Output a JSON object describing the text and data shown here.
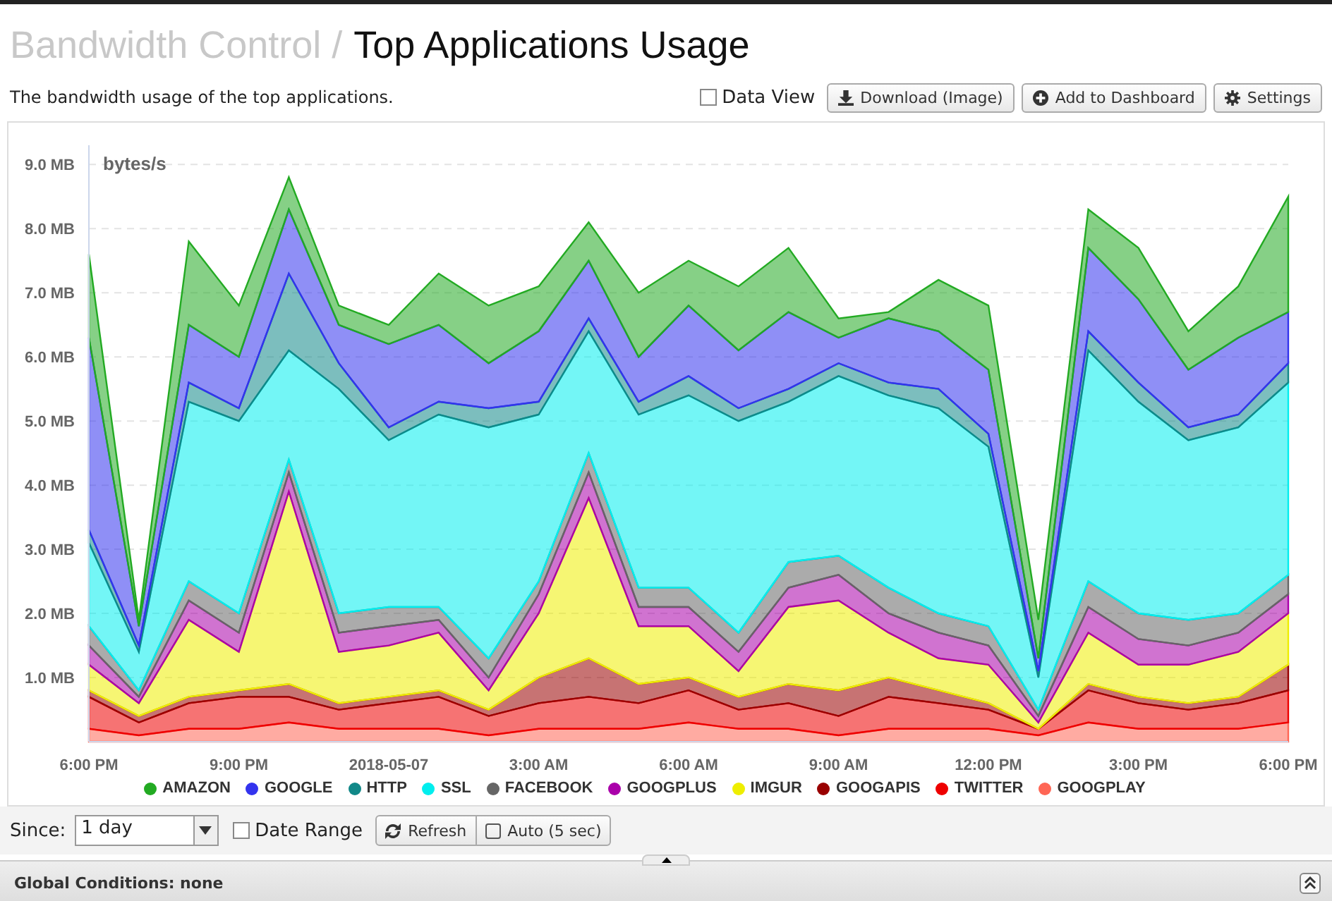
{
  "header": {
    "section": "Bandwidth Control /",
    "title": "Top Applications Usage"
  },
  "description": "The bandwidth usage of the top applications.",
  "toolbar": {
    "data_view": {
      "label": "Data View",
      "checked": false
    },
    "buttons": [
      {
        "kind": "download",
        "label": "Download (Image)"
      },
      {
        "kind": "add",
        "label": "Add to Dashboard"
      },
      {
        "kind": "settings",
        "label": "Settings"
      }
    ]
  },
  "chart": {
    "chart_data": {
      "type": "area",
      "stacked": true,
      "grid": true,
      "ylabel": "bytes/s",
      "ylim": [
        0,
        9.3
      ],
      "categories": [
        "6:00 PM",
        null,
        null,
        "9:00 PM",
        null,
        null,
        "2018-05-07",
        null,
        null,
        "3:00 AM",
        null,
        null,
        "6:00 AM",
        null,
        null,
        "9:00 AM",
        null,
        null,
        "12:00 PM",
        null,
        null,
        "3:00 PM",
        null,
        null,
        "6:00 PM"
      ],
      "yticks": [
        {
          "value": 1,
          "label": "1.0 MB"
        },
        {
          "value": 2,
          "label": "2.0 MB"
        },
        {
          "value": 3,
          "label": "3.0 MB"
        },
        {
          "value": 4,
          "label": "4.0 MB"
        },
        {
          "value": 5,
          "label": "5.0 MB"
        },
        {
          "value": 6,
          "label": "6.0 MB"
        },
        {
          "value": 7,
          "label": "7.0 MB"
        },
        {
          "value": 8,
          "label": "8.0 MB"
        },
        {
          "value": 9,
          "label": "9.0 MB"
        }
      ],
      "series": [
        {
          "name": "AMAZON",
          "color": "#22aa22",
          "values": [
            1.3,
            0.1,
            1.3,
            0.8,
            0.5,
            0.3,
            0.3,
            0.8,
            0.9,
            0.7,
            0.6,
            1.0,
            0.7,
            1.0,
            1.0,
            0.3,
            0.1,
            0.8,
            1.0,
            0.6,
            0.6,
            0.8,
            0.6,
            0.8,
            1.8
          ]
        },
        {
          "name": "GOOGLE",
          "color": "#3333ee",
          "values": [
            3.0,
            0.3,
            0.9,
            0.8,
            1.0,
            0.6,
            1.3,
            1.2,
            0.7,
            1.1,
            0.9,
            0.7,
            1.1,
            0.9,
            1.2,
            0.4,
            1.0,
            0.9,
            1.0,
            0.2,
            1.3,
            1.3,
            0.9,
            1.2,
            0.8
          ]
        },
        {
          "name": "HTTP",
          "color": "#118888",
          "values": [
            0.2,
            0.1,
            0.3,
            0.2,
            1.2,
            0.4,
            0.2,
            0.2,
            0.3,
            0.2,
            0.2,
            0.2,
            0.3,
            0.2,
            0.2,
            0.2,
            0.2,
            0.3,
            0.2,
            0.1,
            0.3,
            0.3,
            0.2,
            0.2,
            0.3
          ]
        },
        {
          "name": "SSL",
          "color": "#00eeee",
          "values": [
            1.3,
            0.6,
            2.8,
            3.0,
            1.7,
            3.5,
            2.6,
            3.0,
            3.6,
            2.6,
            1.9,
            2.7,
            3.0,
            3.3,
            2.5,
            2.8,
            3.0,
            3.2,
            2.8,
            0.5,
            3.6,
            3.3,
            2.8,
            2.9,
            3.0
          ]
        },
        {
          "name": "FACEBOOK",
          "color": "#666666",
          "values": [
            0.3,
            0.1,
            0.3,
            0.3,
            0.2,
            0.3,
            0.3,
            0.2,
            0.3,
            0.2,
            0.3,
            0.3,
            0.3,
            0.3,
            0.4,
            0.3,
            0.4,
            0.3,
            0.3,
            0.1,
            0.4,
            0.4,
            0.4,
            0.3,
            0.3
          ]
        },
        {
          "name": "GOOGPLUS",
          "color": "#aa00aa",
          "values": [
            0.3,
            0.1,
            0.3,
            0.3,
            0.3,
            0.3,
            0.3,
            0.2,
            0.2,
            0.3,
            0.4,
            0.3,
            0.3,
            0.3,
            0.3,
            0.4,
            0.3,
            0.4,
            0.3,
            0.1,
            0.4,
            0.4,
            0.3,
            0.3,
            0.3
          ]
        },
        {
          "name": "IMGUR",
          "color": "#eeee00",
          "values": [
            0.4,
            0.2,
            1.2,
            0.6,
            3.0,
            0.8,
            0.8,
            0.9,
            0.3,
            1.0,
            2.5,
            0.9,
            0.8,
            0.4,
            1.2,
            1.4,
            0.7,
            0.5,
            0.6,
            0.1,
            0.8,
            0.5,
            0.6,
            0.7,
            0.8
          ]
        },
        {
          "name": "GOOGAPIS",
          "color": "#990000",
          "values": [
            0.1,
            0.1,
            0.1,
            0.1,
            0.2,
            0.1,
            0.1,
            0.1,
            0.1,
            0.4,
            0.6,
            0.3,
            0.2,
            0.2,
            0.3,
            0.4,
            0.3,
            0.2,
            0.1,
            0.0,
            0.1,
            0.1,
            0.1,
            0.1,
            0.4
          ]
        },
        {
          "name": "TWITTER",
          "color": "#ee0000",
          "values": [
            0.5,
            0.2,
            0.4,
            0.5,
            0.4,
            0.3,
            0.4,
            0.5,
            0.3,
            0.4,
            0.5,
            0.4,
            0.5,
            0.3,
            0.4,
            0.3,
            0.5,
            0.4,
            0.3,
            0.1,
            0.5,
            0.4,
            0.3,
            0.4,
            0.5
          ]
        },
        {
          "name": "GOOGPLAY",
          "color": "#ff6655",
          "values": [
            0.2,
            0.1,
            0.2,
            0.2,
            0.3,
            0.2,
            0.2,
            0.2,
            0.1,
            0.2,
            0.2,
            0.2,
            0.3,
            0.2,
            0.2,
            0.1,
            0.2,
            0.2,
            0.2,
            0.1,
            0.3,
            0.2,
            0.2,
            0.2,
            0.3
          ]
        }
      ]
    }
  },
  "footer": {
    "since": {
      "label": "Since:",
      "value": "1 day"
    },
    "date_range": {
      "label": "Date Range",
      "checked": false
    },
    "refresh": "Refresh",
    "auto": {
      "label": "Auto (5 sec)",
      "checked": false
    }
  },
  "conditions_bar": {
    "label": "Global Conditions: none"
  }
}
